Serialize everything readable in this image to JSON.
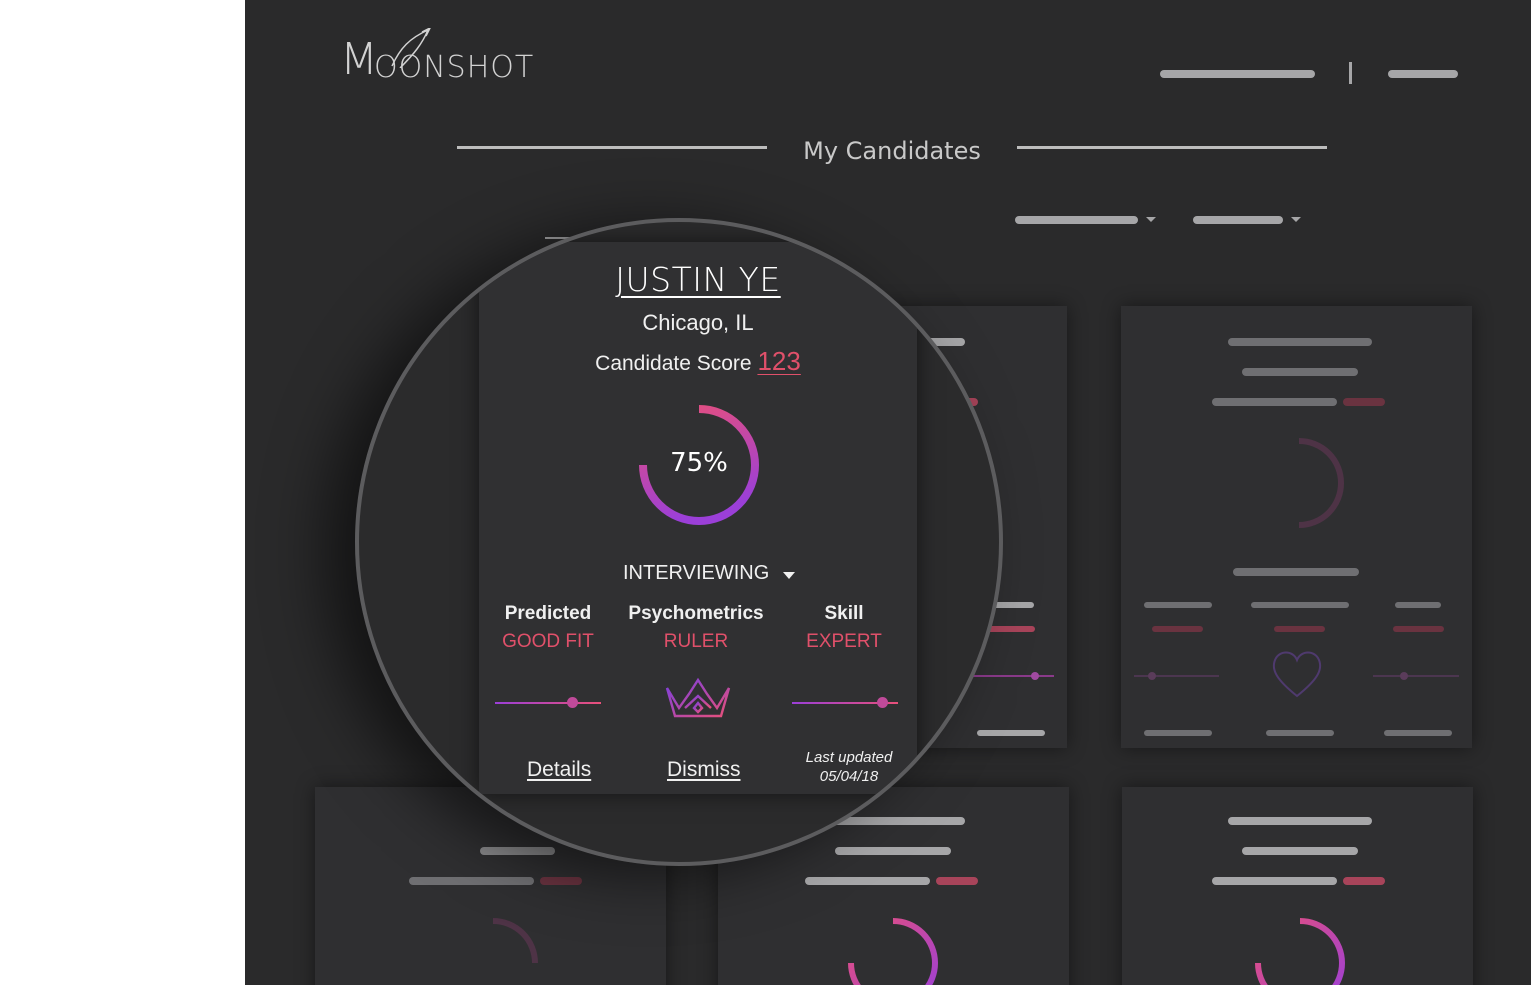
{
  "brand": {
    "name": "OONSHOT",
    "initial": "M"
  },
  "page": {
    "title": "My Candidates"
  },
  "featured_candidate": {
    "name": "JUSTIN YE",
    "location": "Chicago, IL",
    "score_label": "Candidate Score",
    "score_value": "123",
    "match_percent_label": "75%",
    "match_percent": 0.75,
    "status": "INTERVIEWING",
    "metrics": [
      {
        "label": "Predicted",
        "value": "GOOD FIT",
        "slider_level": 0.73
      },
      {
        "label": "Psychometrics",
        "value": "RULER",
        "icon": "crown-icon"
      },
      {
        "label": "Skill",
        "value": "EXPERT",
        "slider_level": 0.85
      }
    ],
    "actions": {
      "details": "Details",
      "dismiss": "Dismiss"
    },
    "last_updated_label": "Last updated",
    "last_updated_date": "05/04/18"
  },
  "colors": {
    "accent": "#e0506a",
    "ring_start": "#e8507a",
    "ring_end": "#9b3fd8",
    "background": "#2a2a2b"
  }
}
